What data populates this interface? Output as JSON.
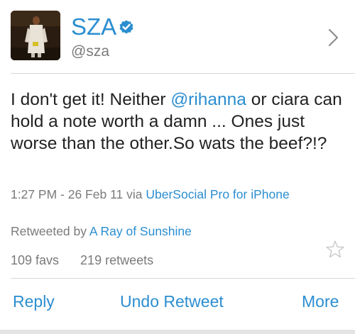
{
  "profile": {
    "name": "SZA",
    "handle": "@sza",
    "verified_icon": "verified-badge",
    "chevron_icon": "chevron-right"
  },
  "tweet": {
    "text_before": "I don't get it! Neither ",
    "mention": "@rihanna",
    "text_after": " or ciara can hold a note worth a damn ... Ones just worse than the other.So wats the beef?!?"
  },
  "meta": {
    "timestamp": "1:27 PM - 26 Feb 11",
    "via_prefix": " via ",
    "source": "UberSocial Pro for iPhone"
  },
  "retweet": {
    "prefix": "Retweeted by ",
    "user": "A Ray of Sunshine"
  },
  "counts": {
    "favs": "109 favs",
    "retweets": "219 retweets"
  },
  "actions": {
    "reply": "Reply",
    "undo_retweet": "Undo Retweet",
    "more": "More"
  },
  "colors": {
    "accent": "#2b8ed0",
    "text": "#222222",
    "muted": "#7a7a7a"
  }
}
